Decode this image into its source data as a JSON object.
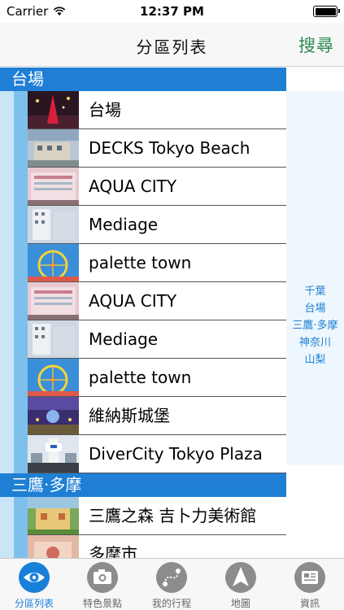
{
  "status": {
    "carrier": "Carrier",
    "time": "12:37 PM"
  },
  "nav": {
    "title": "分區列表",
    "search": "搜尋"
  },
  "sections": [
    {
      "title": "台場"
    },
    {
      "title": "三鷹·多摩"
    }
  ],
  "rows": [
    {
      "label": "台場"
    },
    {
      "label": "DECKS Tokyo Beach"
    },
    {
      "label": "AQUA CITY"
    },
    {
      "label": "Mediage"
    },
    {
      "label": "palette town"
    },
    {
      "label": "AQUA CITY"
    },
    {
      "label": "Mediage"
    },
    {
      "label": "palette town"
    },
    {
      "label": "維納斯城堡"
    },
    {
      "label": "DiverCity Tokyo Plaza"
    },
    {
      "label": "三鷹之森 吉卜力美術館"
    },
    {
      "label": "多摩市"
    }
  ],
  "index": [
    "千葉",
    "台場",
    "三鷹·多摩",
    "神奈川",
    "山梨"
  ],
  "tabs": [
    {
      "label": "分區列表",
      "icon": "eye-icon"
    },
    {
      "label": "特色景點",
      "icon": "camera-icon"
    },
    {
      "label": "我的行程",
      "icon": "route-icon"
    },
    {
      "label": "地圖",
      "icon": "compass-icon"
    },
    {
      "label": "資訊",
      "icon": "news-icon"
    }
  ],
  "colors": {
    "accent": "#1e7fd4",
    "search": "#2e8b57"
  }
}
